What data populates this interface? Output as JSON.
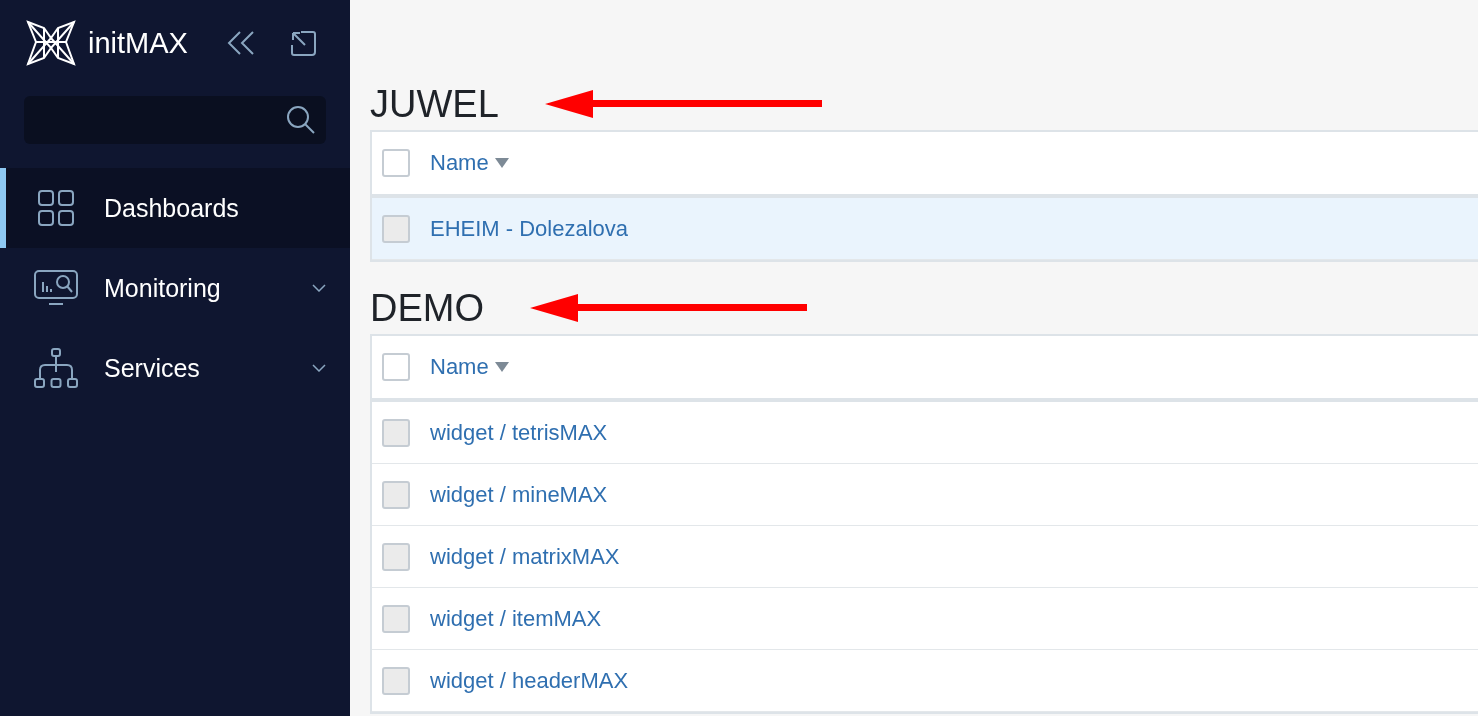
{
  "sidebar": {
    "logo": "initMAX",
    "items": [
      {
        "label": "Dashboards",
        "kind": "dashboards",
        "selected": true,
        "expandable": false
      },
      {
        "label": "Monitoring",
        "kind": "monitoring",
        "selected": false,
        "expandable": true
      },
      {
        "label": "Services",
        "kind": "services",
        "selected": false,
        "expandable": true
      }
    ]
  },
  "groups": [
    {
      "title": "JUWEL",
      "annotated": true,
      "column": "Name",
      "all_checked": false,
      "rows": [
        {
          "name": "EHEIM - Dolezalova",
          "selected": true,
          "checked": false
        }
      ]
    },
    {
      "title": "DEMO",
      "annotated": true,
      "column": "Name",
      "all_checked": false,
      "rows": [
        {
          "name": "widget / tetrisMAX",
          "selected": false,
          "checked": false
        },
        {
          "name": "widget / mineMAX",
          "selected": false,
          "checked": false
        },
        {
          "name": "widget / matrixMAX",
          "selected": false,
          "checked": false
        },
        {
          "name": "widget / itemMAX",
          "selected": false,
          "checked": false
        },
        {
          "name": "widget / headerMAX",
          "selected": false,
          "checked": false
        }
      ]
    }
  ]
}
